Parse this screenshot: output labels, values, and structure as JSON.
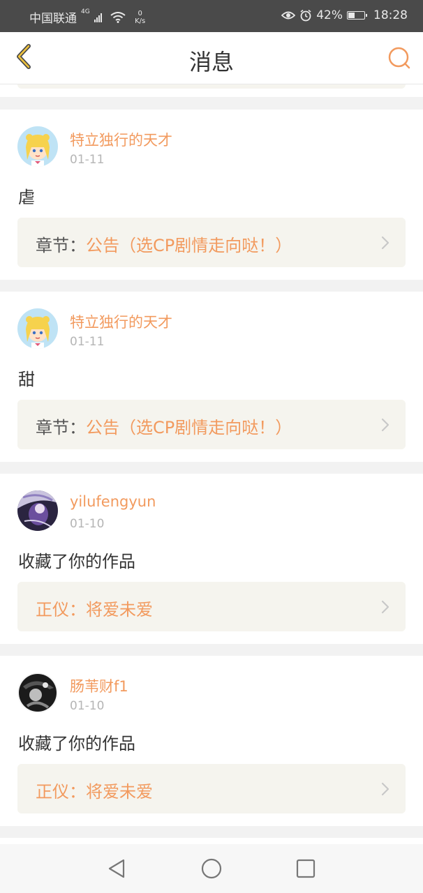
{
  "status_bar": {
    "carrier": "中国联通",
    "network": "4G",
    "speed_value": "0",
    "speed_unit": "K/s",
    "battery": "42%",
    "battery_level": 0.42,
    "time": "18:28"
  },
  "header": {
    "title": "消息",
    "back_icon": "chevron-left-icon",
    "search_icon": "search-icon"
  },
  "messages": [
    {
      "user": "特立独行的天才",
      "date": "01-11",
      "text": "虐",
      "ref_prefix": "章节：",
      "ref_link": "公告（选CP剧情走向哒！）"
    },
    {
      "user": "特立独行的天才",
      "date": "01-11",
      "text": "甜",
      "ref_prefix": "章节：",
      "ref_link": "公告（选CP剧情走向哒！）"
    },
    {
      "user": "yilufengyun",
      "date": "01-10",
      "text": "收藏了你的作品",
      "ref_full": "正仪：将爱未爱"
    },
    {
      "user": "肠苇财f1",
      "date": "01-10",
      "text": "收藏了你的作品",
      "ref_full": "正仪：将爱未爱"
    }
  ],
  "colors": {
    "accent": "#f29a5e",
    "status_bar_bg": "#4a4a4a",
    "page_bg": "#f2f2f2",
    "ref_bg": "#f5f4ee"
  },
  "navbar": {
    "back": "triangle-back-icon",
    "home": "circle-home-icon",
    "recents": "square-recents-icon"
  }
}
